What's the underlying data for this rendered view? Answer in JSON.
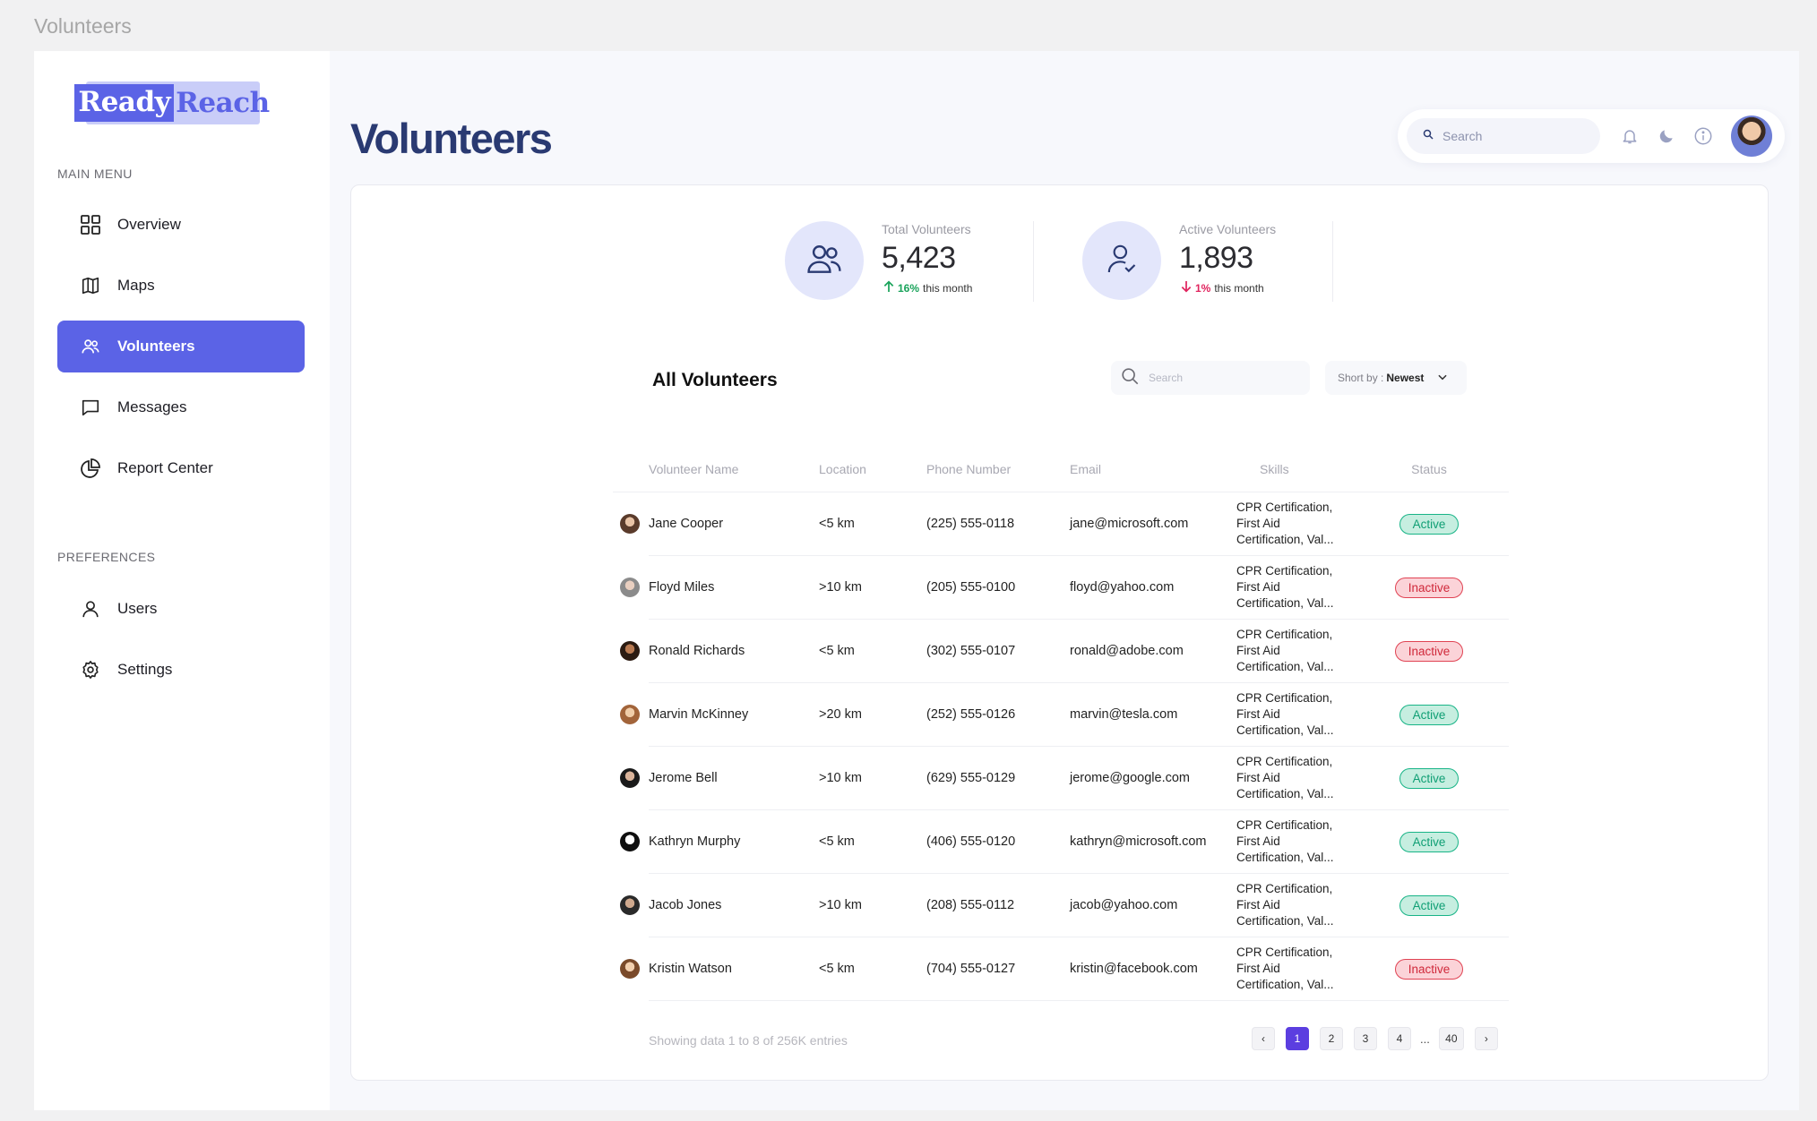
{
  "window": {
    "title": "Volunteers"
  },
  "brand": {
    "part1": "Ready",
    "part2": "Reach"
  },
  "sidebar": {
    "main_menu_label": "MAIN MENU",
    "main_items": [
      {
        "label": "Overview",
        "icon": "grid-icon"
      },
      {
        "label": "Maps",
        "icon": "map-icon"
      },
      {
        "label": "Volunteers",
        "icon": "users-icon",
        "active": true
      },
      {
        "label": "Messages",
        "icon": "message-icon"
      },
      {
        "label": "Report Center",
        "icon": "pie-chart-icon"
      }
    ],
    "preferences_label": "PREFERENCES",
    "pref_items": [
      {
        "label": "Users",
        "icon": "user-icon"
      },
      {
        "label": "Settings",
        "icon": "gear-icon"
      }
    ]
  },
  "header": {
    "title": "Volunteers",
    "search_placeholder": "Search"
  },
  "stats": [
    {
      "label": "Total Volunteers",
      "value": "5,423",
      "change": "16%",
      "direction": "up",
      "suffix": "this month"
    },
    {
      "label": "Active Volunteers",
      "value": "1,893",
      "change": "1%",
      "direction": "down",
      "suffix": "this month"
    }
  ],
  "list": {
    "title": "All Volunteers",
    "search_placeholder": "Search",
    "sort_label": "Short by :",
    "sort_value": "Newest",
    "columns": [
      "Volunteer Name",
      "Location",
      "Phone Number",
      "Email",
      "Skills",
      "Status"
    ],
    "rows": [
      {
        "name": "Jane Cooper",
        "location": "<5 km",
        "phone": "(225) 555-0118",
        "email": "jane@microsoft.com",
        "skills": [
          "CPR Certification,",
          "First Aid",
          "Certification, Val..."
        ],
        "status": "Active"
      },
      {
        "name": "Floyd Miles",
        "location": ">10 km",
        "phone": "(205) 555-0100",
        "email": "floyd@yahoo.com",
        "skills": [
          "CPR Certification,",
          "First Aid",
          "Certification, Val..."
        ],
        "status": "Inactive"
      },
      {
        "name": "Ronald Richards",
        "location": "<5 km",
        "phone": "(302) 555-0107",
        "email": "ronald@adobe.com",
        "skills": [
          "CPR Certification,",
          "First Aid",
          "Certification, Val..."
        ],
        "status": "Inactive"
      },
      {
        "name": "Marvin McKinney",
        "location": ">20 km",
        "phone": "(252) 555-0126",
        "email": "marvin@tesla.com",
        "skills": [
          "CPR Certification,",
          "First Aid",
          "Certification, Val..."
        ],
        "status": "Active"
      },
      {
        "name": "Jerome Bell",
        "location": ">10 km",
        "phone": "(629) 555-0129",
        "email": "jerome@google.com",
        "skills": [
          "CPR Certification,",
          "First Aid",
          "Certification, Val..."
        ],
        "status": "Active"
      },
      {
        "name": "Kathryn Murphy",
        "location": "<5 km",
        "phone": "(406) 555-0120",
        "email": "kathryn@microsoft.com",
        "skills": [
          "CPR Certification,",
          "First Aid",
          "Certification, Val..."
        ],
        "status": "Active"
      },
      {
        "name": "Jacob Jones",
        "location": ">10 km",
        "phone": "(208) 555-0112",
        "email": "jacob@yahoo.com",
        "skills": [
          "CPR Certification,",
          "First Aid",
          "Certification, Val..."
        ],
        "status": "Active"
      },
      {
        "name": "Kristin Watson",
        "location": "<5 km",
        "phone": "(704) 555-0127",
        "email": "kristin@facebook.com",
        "skills": [
          "CPR Certification,",
          "First Aid",
          "Certification, Val..."
        ],
        "status": "Inactive"
      }
    ],
    "showing_text": "Showing data 1 to 8 of  256K entries",
    "pagination": {
      "prev": "‹",
      "pages": [
        "1",
        "2",
        "3",
        "4"
      ],
      "current": "1",
      "ellipsis": "...",
      "last": "40",
      "next": "›"
    }
  },
  "colors": {
    "accent": "#5b63e6",
    "title": "#2a3a72",
    "active": "#18b487",
    "inactive": "#e04353"
  }
}
